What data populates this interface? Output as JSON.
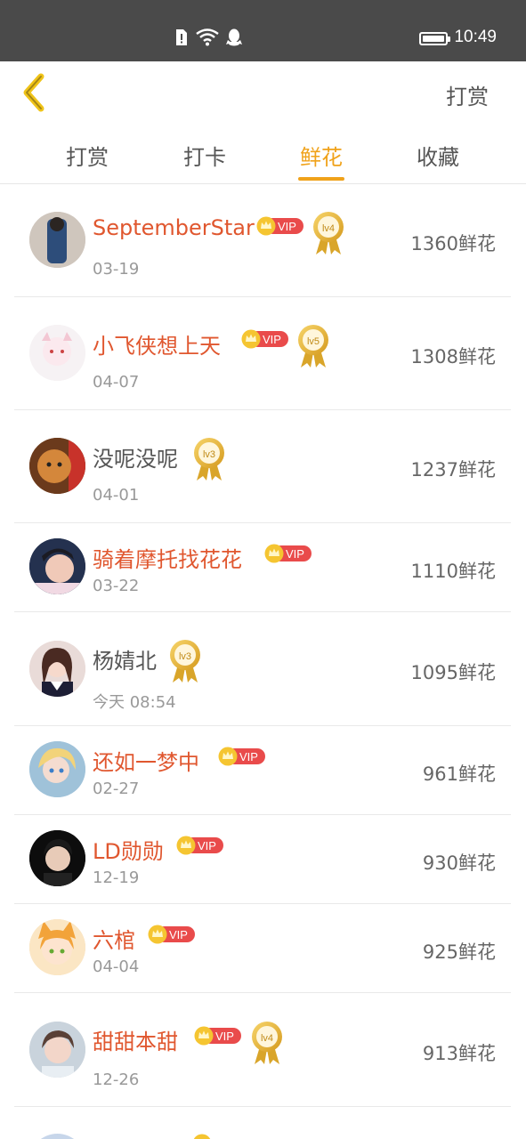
{
  "status_bar": {
    "time": "10:49",
    "icons": [
      "sim-alert-icon",
      "wifi-icon",
      "qq-icon",
      "battery-icon"
    ]
  },
  "header": {
    "action_label": "打赏"
  },
  "tabs": [
    {
      "label": "打赏",
      "active": false
    },
    {
      "label": "打卡",
      "active": false
    },
    {
      "label": "鲜花",
      "active": true
    },
    {
      "label": "收藏",
      "active": false
    }
  ],
  "colors": {
    "accent": "#f0a21a",
    "vip_name": "#e0572f",
    "vip_badge": "#e94b4b",
    "crown": "#f5c531"
  },
  "list": [
    {
      "name": "SeptemberStar",
      "date": "03-19",
      "amount": "1360鲜花",
      "vip": true,
      "level": "lv4"
    },
    {
      "name": "小飞侠想上天",
      "date": "04-07",
      "amount": "1308鲜花",
      "vip": true,
      "level": "lv5"
    },
    {
      "name": "没呢没呢",
      "date": "04-01",
      "amount": "1237鲜花",
      "vip": false,
      "level": "lv3"
    },
    {
      "name": "骑着摩托找花花",
      "date": "03-22",
      "amount": "1110鲜花",
      "vip": true,
      "level": ""
    },
    {
      "name": "杨婧北",
      "date": "今天 08:54",
      "amount": "1095鲜花",
      "vip": false,
      "level": "lv3"
    },
    {
      "name": "还如一梦中",
      "date": "02-27",
      "amount": "961鲜花",
      "vip": true,
      "level": ""
    },
    {
      "name": "LD勋勋",
      "date": "12-19",
      "amount": "930鲜花",
      "vip": true,
      "level": ""
    },
    {
      "name": "六棺",
      "date": "04-04",
      "amount": "925鲜花",
      "vip": true,
      "level": ""
    },
    {
      "name": "甜甜本甜",
      "date": "12-26",
      "amount": "913鲜花",
      "vip": true,
      "level": "lv4"
    }
  ],
  "vip_label": "VIP"
}
